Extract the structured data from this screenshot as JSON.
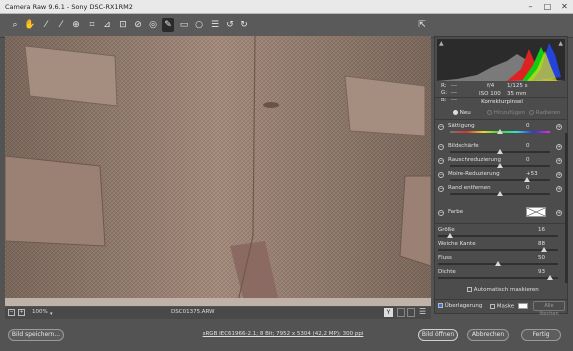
{
  "window": {
    "title": "Camera Raw 9.6.1 - Sony DSC-RX1RM2",
    "minimize": "–",
    "maximize": "□",
    "close": "✕"
  },
  "toolbar": {
    "tools": [
      "zoom-icon",
      "hand-icon",
      "white-balance-icon",
      "color-sampler-icon",
      "target-adjust-icon",
      "crop-icon",
      "straighten-icon",
      "transform-icon",
      "spot-removal-icon",
      "red-eye-icon",
      "adjustment-brush-icon",
      "graduated-filter-icon",
      "radial-filter-icon",
      "presets-list-icon",
      "rotate-left-icon",
      "rotate-right-icon"
    ],
    "active_tool": "adjustment-brush-icon",
    "fullscreen_icon": "fullscreen-icon"
  },
  "info": {
    "r_label": "R:",
    "r_val": "---",
    "g_label": "G:",
    "g_val": "---",
    "b_label": "B:",
    "b_val": "---",
    "aperture": "f/4",
    "shutter": "1/125 s",
    "iso": "ISO 100",
    "focal": "35 mm"
  },
  "panel": {
    "title": "Korrekturpinsel",
    "modes": [
      "Neu",
      "Hinzufügen",
      "Radieren"
    ],
    "sliders_top": [
      {
        "label": "Sättigung",
        "value": "0",
        "pos": 0.5
      },
      {
        "label": "Bildschärfe",
        "value": "0",
        "pos": 0.5
      },
      {
        "label": "Rauschreduzierung",
        "value": "0",
        "pos": 0.5
      },
      {
        "label": "Moire-Reduzierung",
        "value": "+53",
        "pos": 0.77
      },
      {
        "label": "Rand entfernen",
        "value": "0",
        "pos": 0.5
      }
    ],
    "color_label": "Farbe",
    "brush": [
      {
        "label": "Größe",
        "value": "16",
        "pos": 0.1
      },
      {
        "label": "Weiche Kante",
        "value": "88",
        "pos": 0.88
      },
      {
        "label": "Fluss",
        "value": "50",
        "pos": 0.5
      },
      {
        "label": "Dichte",
        "value": "93",
        "pos": 0.93
      }
    ],
    "auto_mask": "Automatisch maskieren",
    "overlay": "Überlagerung",
    "mask": "Maske",
    "delete_all": "Alle löschen"
  },
  "statusbar": {
    "zoom": "100%",
    "filename": "DSC01375.ARW",
    "view_icon": "Y"
  },
  "footer": {
    "save": "Bild speichern...",
    "workflow": "sRGB IEC61966-2.1; 8 Bit; 7952 x 5304 (42,2 MP); 300 ppi",
    "open": "Bild öffnen",
    "cancel": "Abbrechen",
    "done": "Fertig"
  }
}
